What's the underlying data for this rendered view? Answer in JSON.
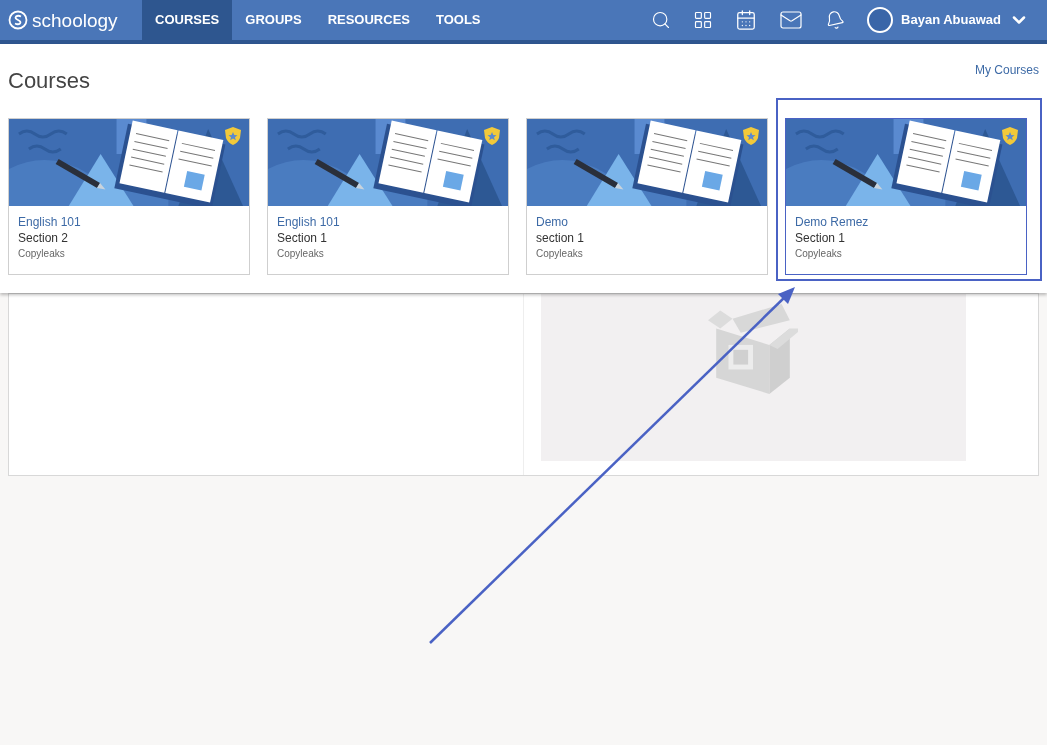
{
  "nav": {
    "logo": "schoology",
    "tabs": [
      {
        "label": "COURSES",
        "selected": true
      },
      {
        "label": "GROUPS",
        "selected": false
      },
      {
        "label": "RESOURCES",
        "selected": false
      },
      {
        "label": "TOOLS",
        "selected": false
      }
    ],
    "user": {
      "name": "Bayan Abuawad"
    }
  },
  "page": {
    "title": "Courses",
    "link": "My Courses"
  },
  "courses": [
    {
      "title": "English 101",
      "section": "Section 2",
      "school": "Copyleaks",
      "highlighted": false
    },
    {
      "title": "English 101",
      "section": "Section 1",
      "school": "Copyleaks",
      "highlighted": false
    },
    {
      "title": "Demo",
      "section": "section 1",
      "school": "Copyleaks",
      "highlighted": false
    },
    {
      "title": "Demo Remez",
      "section": "Section 1",
      "school": "Copyleaks",
      "highlighted": true
    }
  ]
}
